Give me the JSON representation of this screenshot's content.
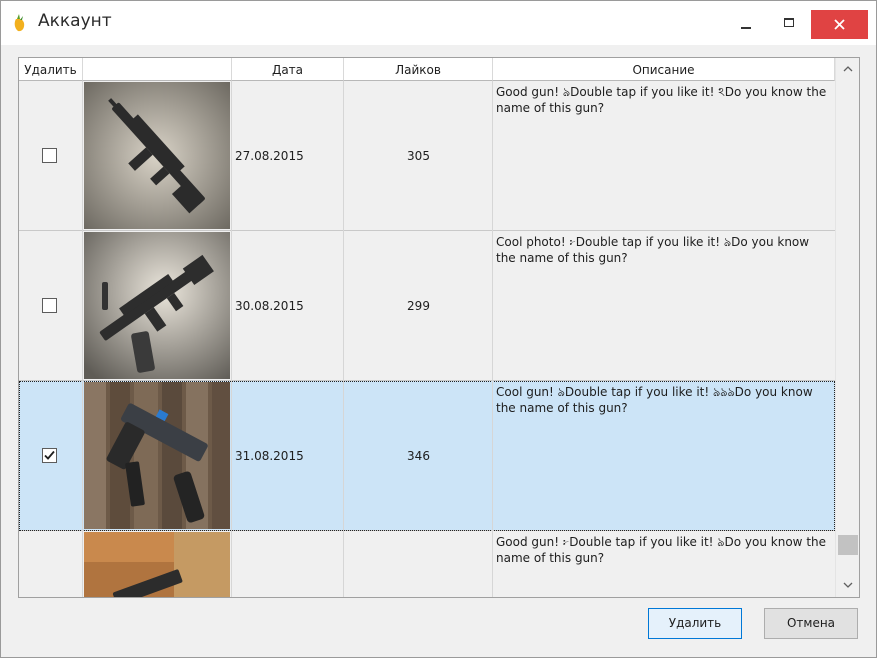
{
  "window": {
    "title": "Аккаунт"
  },
  "grid": {
    "columns": [
      "Удалить",
      "",
      "Дата",
      "Лайков",
      "Описание"
    ],
    "rows": [
      {
        "checked": false,
        "date": "27.08.2015",
        "likes": "305",
        "description": "Good gun! ঌDouble tap if you like it! ঽDo you know the name of this gun?",
        "selected": false,
        "image": "rifle-on-concrete-photo"
      },
      {
        "checked": false,
        "date": "30.08.2015",
        "likes": "299",
        "description": "Cool photo! ፦Double tap if you like it! ঌDo you know the name of this gun?",
        "selected": false,
        "image": "rifle-with-suppressor-photo"
      },
      {
        "checked": true,
        "date": "31.08.2015",
        "likes": "346",
        "description": "Cool gun! ঌDouble tap if you like it! ঌঌঌDo you know the name of this gun?",
        "selected": true,
        "image": "pistol-on-wood-photo"
      },
      {
        "checked": false,
        "date": "",
        "likes": "",
        "description": "Good gun! ፦Double tap if you like it! ঌDo you know the name of this gun?",
        "selected": false,
        "image": "pistol-on-leather-photo"
      }
    ],
    "scroll_position": 0.96
  },
  "buttons": {
    "delete": "Удалить",
    "cancel": "Отмена"
  },
  "colors": {
    "selection": "#cce4f7",
    "close": "#e04343",
    "primary_border": "#0078d7"
  }
}
